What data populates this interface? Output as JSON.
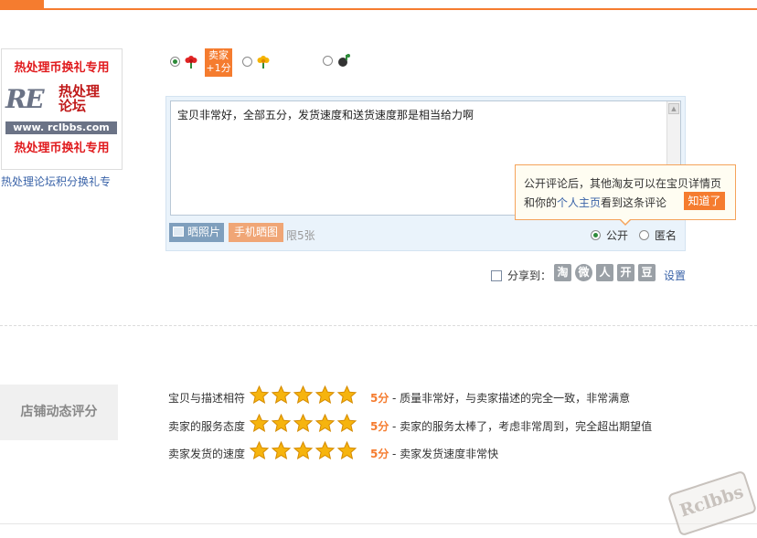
{
  "product": {
    "image_line1": "热处理币换礼专用",
    "image_logo": "RE",
    "image_logo_cn": "热处理\n论坛",
    "image_url": "www. rclbbs.com",
    "image_line3": "热处理币换礼专用",
    "caption": "热处理论坛积分换礼专"
  },
  "rating": {
    "options": [
      {
        "name": "good",
        "selected": true,
        "icon": "red-flower-icon"
      },
      {
        "name": "neutral",
        "selected": false,
        "icon": "yellow-flower-icon"
      },
      {
        "name": "bad",
        "selected": false,
        "icon": "black-bomb-icon"
      }
    ],
    "seller_badge_line1": "卖家",
    "seller_badge_line2": "+1分"
  },
  "comment": {
    "text": "宝贝非常好，全部五分，发货速度和送货速度那是相当给力啊",
    "photo_button": "晒照片",
    "mobile_button": "手机晒图",
    "limit": "限5张",
    "public_label": "公开",
    "anonymous_label": "匿名",
    "public_selected": true
  },
  "tooltip": {
    "line1": "公开评论后，其他淘友可以在宝贝详情页",
    "line2_pre": "和你的",
    "line2_link": "个人主页",
    "line2_post": "看到这条评论",
    "button": "知道了"
  },
  "share": {
    "label": "分享到：",
    "icons": [
      "淘",
      "微",
      "人",
      "开",
      "豆"
    ],
    "settings": "设置"
  },
  "store_rating": {
    "title": "店铺动态评分",
    "rows": [
      {
        "label": "宝贝与描述相符",
        "stars": 5,
        "score": "5分",
        "desc": "- 质量非常好，与卖家描述的完全一致，非常满意"
      },
      {
        "label": "卖家的服务态度",
        "stars": 5,
        "score": "5分",
        "desc": "- 卖家的服务太棒了，考虑非常周到，完全超出期望值"
      },
      {
        "label": "卖家发货的速度",
        "stars": 5,
        "score": "5分",
        "desc": "- 卖家发货速度非常快"
      }
    ]
  },
  "watermark": "Rclbbs",
  "colors": {
    "accent": "#f57c2f",
    "link": "#3a63a8",
    "panel": "#eaf3fb"
  }
}
